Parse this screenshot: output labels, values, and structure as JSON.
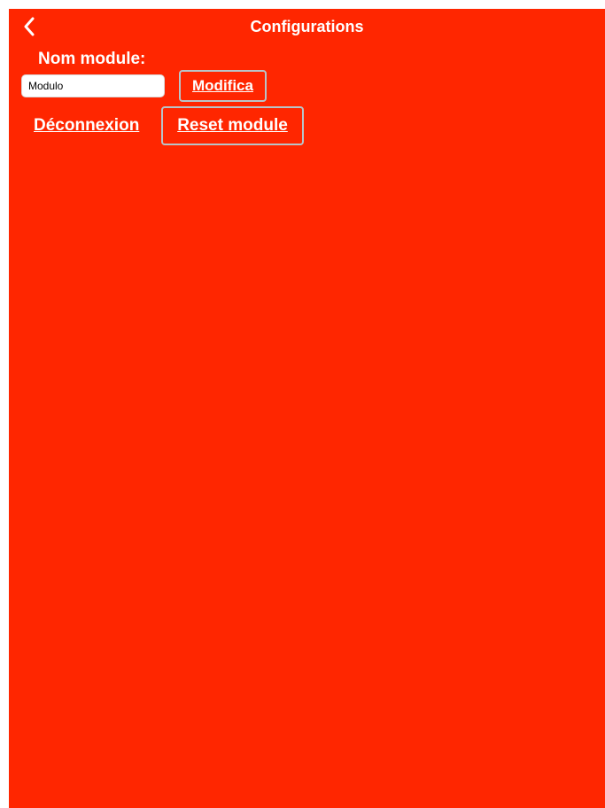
{
  "nav": {
    "title": "Configurations",
    "back_icon": "chevron-left-icon"
  },
  "module": {
    "label": "Nom module:",
    "input_value": "Modulo",
    "modify_label": "Modifica"
  },
  "actions": {
    "logout_label": "Déconnexion",
    "reset_label": "Reset module"
  },
  "colors": {
    "background": "#ff2600",
    "text": "#ffffff",
    "button_border": "#b8c4c8"
  }
}
